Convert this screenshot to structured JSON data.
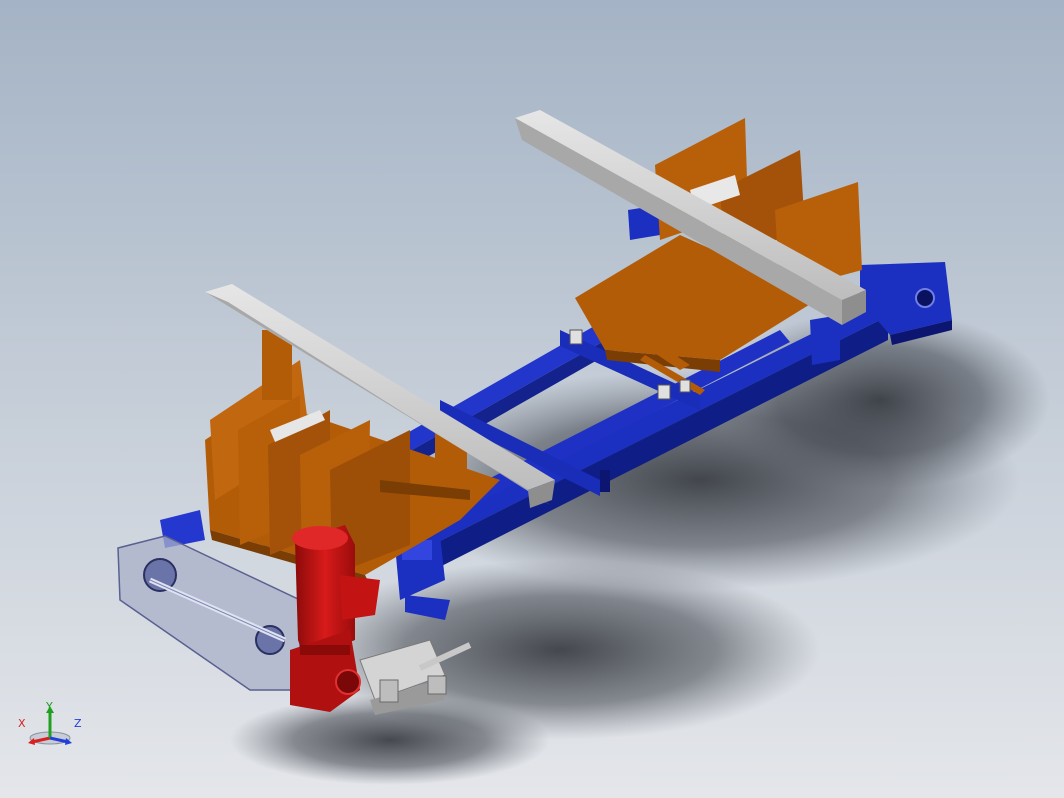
{
  "viewport": {
    "background_top": "#a4b3c5",
    "background_bottom": "#e4e6ea"
  },
  "model": {
    "frame_color": "#1b2fc0",
    "plate_color": "#b35c08",
    "beam_color": "#c9c9c9",
    "motor_color": "#c41313",
    "guard_color": "#aab0c8"
  },
  "triad": {
    "x_label": "X",
    "y_label": "Y",
    "z_label": "Z",
    "x_color": "#d82020",
    "y_color": "#20a020",
    "z_color": "#2040d8"
  }
}
